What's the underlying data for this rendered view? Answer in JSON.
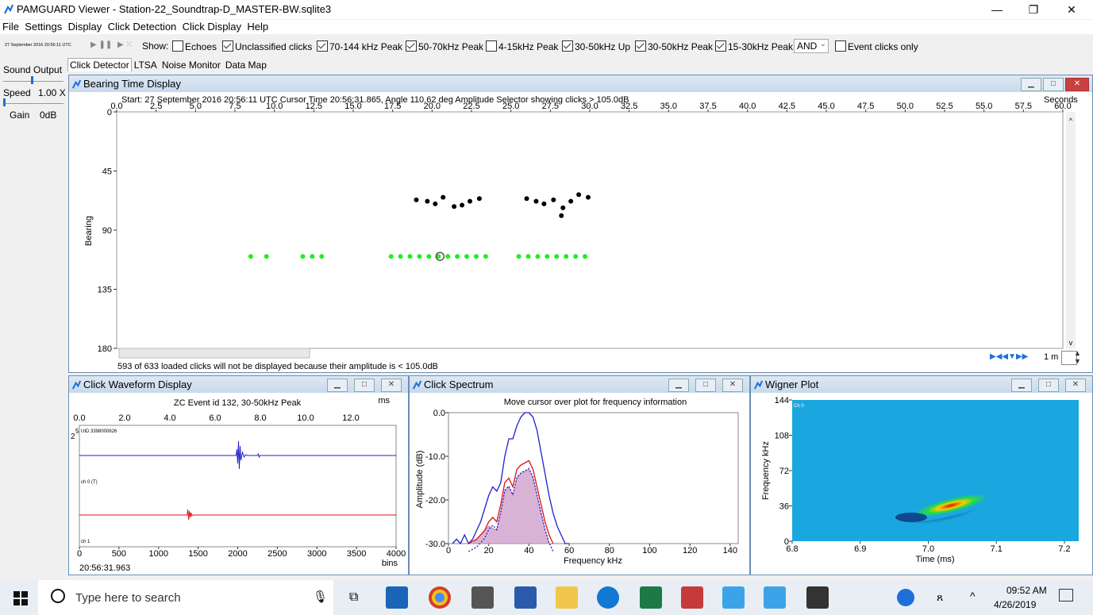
{
  "window": {
    "title": "PAMGUARD Viewer - Station-22_Soundtrap-D_MASTER-BW.sqlite3",
    "minimize": "—",
    "restore": "❐",
    "close": "✕"
  },
  "menu": [
    "File",
    "Settings",
    "Display",
    "Click Detection",
    "Click Display",
    "Help"
  ],
  "toolbar": {
    "datetime": "27 September 2016 20:56:11 UTC",
    "show_label": "Show:",
    "checkboxes": [
      {
        "label": "Echoes",
        "checked": false
      },
      {
        "label": "Unclassified clicks",
        "checked": true
      },
      {
        "label": "70-144 kHz Peak",
        "checked": true
      },
      {
        "label": "50-70kHz Peak",
        "checked": true
      },
      {
        "label": "4-15kHz Peak",
        "checked": false
      },
      {
        "label": "30-50kHz Up",
        "checked": true
      },
      {
        "label": "30-50kHz Peak",
        "checked": true
      },
      {
        "label": "15-30kHz Peak",
        "checked": true
      }
    ],
    "logic_select": "AND",
    "event_clicks_only": {
      "label": "Event clicks only",
      "checked": false
    }
  },
  "left_panel": {
    "sound_output": "Sound Output",
    "speed_label": "Speed",
    "speed_value": "1.00 X",
    "gain_label": "Gain",
    "gain_value": "0dB"
  },
  "tabs": [
    "Click Detector",
    "LTSA",
    "Noise Monitor",
    "Data Map"
  ],
  "bearing_display": {
    "title": "Bearing Time Display",
    "info": "Start: 27 September 2016 20:56:11 UTC Cursor Time 20:56:31.865, Angle 110.62 deg   Amplitude Selector showing clicks > 105.0dB",
    "seconds_label": "Seconds",
    "x_ticks": [
      "0.0",
      "2.5",
      "5.0",
      "7.5",
      "10.0",
      "12.5",
      "15.0",
      "17.5",
      "20.0",
      "22.5",
      "25.0",
      "27.5",
      "30.0",
      "32.5",
      "35.0",
      "37.5",
      "40.0",
      "42.5",
      "45.0",
      "47.5",
      "50.0",
      "52.5",
      "55.0",
      "57.5",
      "60.0"
    ],
    "y_ticks": [
      "0",
      "45",
      "90",
      "135",
      "180"
    ],
    "y_label": "Bearing",
    "footer": "593 of 633 loaded clicks will not be displayed because their amplitude is < 105.0dB",
    "time_span": "1 m",
    "black_clicks": [
      [
        19.0,
        67
      ],
      [
        19.7,
        68
      ],
      [
        20.2,
        70
      ],
      [
        20.7,
        65
      ],
      [
        21.4,
        72
      ],
      [
        21.9,
        71
      ],
      [
        22.4,
        68
      ],
      [
        23.0,
        66
      ],
      [
        26.0,
        66
      ],
      [
        26.6,
        68
      ],
      [
        27.1,
        70
      ],
      [
        27.7,
        67
      ],
      [
        28.3,
        73
      ],
      [
        28.8,
        68
      ],
      [
        29.3,
        63
      ],
      [
        29.9,
        65
      ],
      [
        28.2,
        79
      ]
    ],
    "green_clicks": [
      [
        8.5,
        110
      ],
      [
        9.5,
        110
      ],
      [
        11.8,
        110
      ],
      [
        12.4,
        110
      ],
      [
        13.0,
        110
      ],
      [
        17.4,
        110
      ],
      [
        18.0,
        110
      ],
      [
        18.6,
        110
      ],
      [
        19.2,
        110
      ],
      [
        19.8,
        110
      ],
      [
        20.4,
        110
      ],
      [
        21.0,
        110
      ],
      [
        21.6,
        110
      ],
      [
        22.2,
        110
      ],
      [
        22.8,
        110
      ],
      [
        23.4,
        110
      ],
      [
        25.5,
        110
      ],
      [
        26.1,
        110
      ],
      [
        26.7,
        110
      ],
      [
        27.3,
        110
      ],
      [
        27.9,
        110
      ],
      [
        28.5,
        110
      ],
      [
        29.1,
        110
      ],
      [
        29.7,
        110
      ]
    ],
    "selected_click": [
      20.5,
      110
    ]
  },
  "waveform": {
    "title": "Click Waveform Display",
    "subtitle": "ZC Event id 132, 30-50kHz Peak",
    "ms_label": "ms",
    "top_ticks": [
      "0.0",
      "2.0",
      "4.0",
      "6.0",
      "8.0",
      "10.0",
      "12.0"
    ],
    "bottom_ticks": [
      "0",
      "500",
      "1000",
      "1500",
      "2000",
      "2500",
      "3000",
      "3500",
      "4000"
    ],
    "bins_label": "bins",
    "uid": "UID 3398000626",
    "ch0": "ch 0 (T)",
    "ch1": "ch 1",
    "y_top": "2",
    "y_top_exp": "5",
    "time": "20:56:31.963"
  },
  "spectrum": {
    "title": "Click Spectrum",
    "subtitle": "Move cursor over plot for frequency information",
    "y_label": "Amplitude (dB)",
    "y_ticks": [
      "0.0",
      "-10.0",
      "-20.0",
      "-30.0"
    ],
    "x_ticks": [
      "0",
      "20",
      "40",
      "60",
      "80",
      "100",
      "120",
      "140"
    ],
    "x_label": "Frequency kHz",
    "blue_series": [
      [
        2,
        -30
      ],
      [
        4,
        -29
      ],
      [
        6,
        -30
      ],
      [
        8,
        -28
      ],
      [
        10,
        -30
      ],
      [
        12,
        -29
      ],
      [
        14,
        -27
      ],
      [
        16,
        -25
      ],
      [
        18,
        -22
      ],
      [
        20,
        -19
      ],
      [
        22,
        -17
      ],
      [
        24,
        -18
      ],
      [
        26,
        -16
      ],
      [
        28,
        -10
      ],
      [
        30,
        -6
      ],
      [
        32,
        -6
      ],
      [
        34,
        -3
      ],
      [
        36,
        -1
      ],
      [
        38,
        0
      ],
      [
        40,
        0
      ],
      [
        42,
        -1
      ],
      [
        44,
        -4
      ],
      [
        46,
        -9
      ],
      [
        48,
        -14
      ],
      [
        50,
        -19
      ],
      [
        52,
        -23
      ],
      [
        54,
        -26
      ],
      [
        56,
        -28
      ],
      [
        58,
        -30
      ],
      [
        60,
        -30
      ]
    ],
    "red_series": [
      [
        10,
        -30
      ],
      [
        14,
        -29
      ],
      [
        18,
        -27
      ],
      [
        20,
        -25
      ],
      [
        22,
        -24
      ],
      [
        24,
        -25
      ],
      [
        26,
        -21
      ],
      [
        28,
        -16
      ],
      [
        30,
        -15
      ],
      [
        32,
        -17
      ],
      [
        34,
        -13
      ],
      [
        36,
        -12
      ],
      [
        38,
        -11.5
      ],
      [
        40,
        -11
      ],
      [
        42,
        -13
      ],
      [
        44,
        -17
      ],
      [
        46,
        -21
      ],
      [
        48,
        -25
      ],
      [
        50,
        -28
      ],
      [
        52,
        -30
      ]
    ],
    "fill_series": [
      [
        12,
        -30
      ],
      [
        16,
        -28
      ],
      [
        20,
        -26
      ],
      [
        24,
        -27
      ],
      [
        28,
        -18
      ],
      [
        30,
        -17
      ],
      [
        32,
        -19
      ],
      [
        34,
        -15
      ],
      [
        36,
        -14
      ],
      [
        38,
        -13.5
      ],
      [
        40,
        -13
      ],
      [
        42,
        -15
      ],
      [
        44,
        -19
      ],
      [
        46,
        -23
      ],
      [
        48,
        -27
      ],
      [
        50,
        -30
      ]
    ]
  },
  "wigner": {
    "title": "Wigner Plot",
    "y_label": "Frequency kHz",
    "y_ticks": [
      "144",
      "108",
      "72",
      "36",
      "0"
    ],
    "x_ticks": [
      "6.8",
      "6.9",
      "7.0",
      "7.1",
      "7.2"
    ],
    "x_label": "Time (ms)",
    "channel": "Ch 0"
  },
  "taskbar": {
    "search_placeholder": "Type here to search",
    "time": "09:52 AM",
    "date": "4/26/2019"
  },
  "colors": {
    "panel_border": "#6b8fb6",
    "green_click": "#22ee22",
    "blue_trace": "#2020cc",
    "red_trace": "#dd1111",
    "spectrum_fill": "#d9b3d6",
    "wigner_bg": "#1aa7e0"
  }
}
